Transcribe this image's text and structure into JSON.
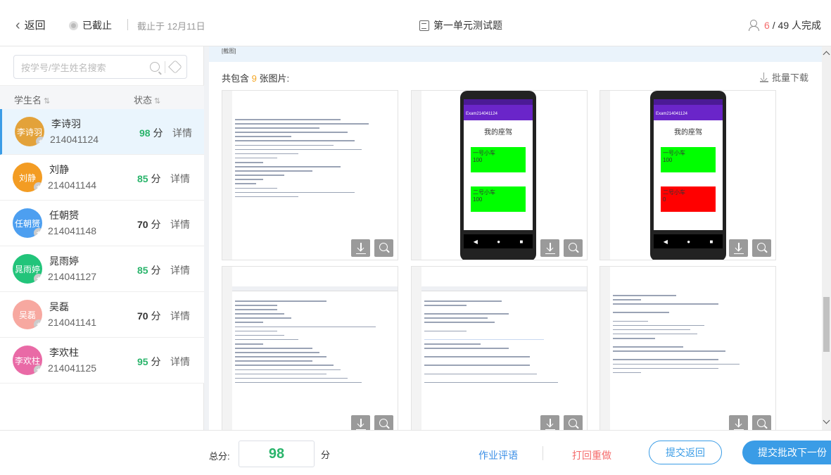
{
  "header": {
    "back_label": "返回",
    "status_label": "已截止",
    "deadline_label": "截止于 12月11日",
    "assignment_title": "第一单元测试题",
    "completed_count": "6",
    "total_text": "/ 49 人完成"
  },
  "sidebar": {
    "search_placeholder": "按学号/学生姓名搜索",
    "col_name": "学生名",
    "col_status": "状态",
    "sort_glyph": "⇅",
    "students": [
      {
        "avatar_text": "李诗羽",
        "name": "李诗羽",
        "id": "214041124",
        "score": "98",
        "score_unit": "分",
        "detail": "详情",
        "color": "#e3a23a"
      },
      {
        "avatar_text": "刘静",
        "name": "刘静",
        "id": "214041144",
        "score": "85",
        "score_unit": "分",
        "detail": "详情",
        "color": "#f39c23"
      },
      {
        "avatar_text": "任朝赟",
        "name": "任朝赟",
        "id": "214041148",
        "score": "70",
        "score_unit": "分",
        "detail": "详情",
        "color": "#4d9ff0"
      },
      {
        "avatar_text": "晁雨婷",
        "name": "晁雨婷",
        "id": "214041127",
        "score": "85",
        "score_unit": "分",
        "detail": "详情",
        "color": "#22c47a"
      },
      {
        "avatar_text": "吴磊",
        "name": "吴磊",
        "id": "214041141",
        "score": "70",
        "score_unit": "分",
        "detail": "详情",
        "color": "#f7a8a0"
      },
      {
        "avatar_text": "李欢柱",
        "name": "李欢柱",
        "id": "214041125",
        "score": "95",
        "score_unit": "分",
        "detail": "详情",
        "color": "#e96aa6"
      }
    ]
  },
  "main": {
    "strip_text": "[截图]",
    "image_count_prefix": "共包含",
    "image_count": "9",
    "image_count_suffix": "张图片:",
    "bulk_download": "批量下载",
    "phone_app_bar": "Exam214041124",
    "phone_title": "我的座驾",
    "phone2_box1": "一号小车\n100",
    "phone2_box2": "二号小车\n100",
    "phone3_box1": "一号小车\n100",
    "phone3_box2": "二号小车\n0"
  },
  "footer": {
    "total_label": "总分:",
    "total_score": "98",
    "unit": "分",
    "evaluate": "作业评语",
    "reject": "打回重做",
    "submit_back": "提交返回",
    "submit_next": "提交批改下一份"
  },
  "colors": {
    "accent": "#3a9ce6",
    "score_green": "#2ab46b",
    "danger": "#f56c6c",
    "phone_green": "#00ff00",
    "phone_red": "#ff0000"
  },
  "icons": [
    "chevron-left-icon",
    "stop-circle-icon",
    "document-icon",
    "people-icon",
    "search-icon",
    "tag-icon",
    "sort-icon",
    "star-icon",
    "download-icon",
    "zoom-icon"
  ]
}
